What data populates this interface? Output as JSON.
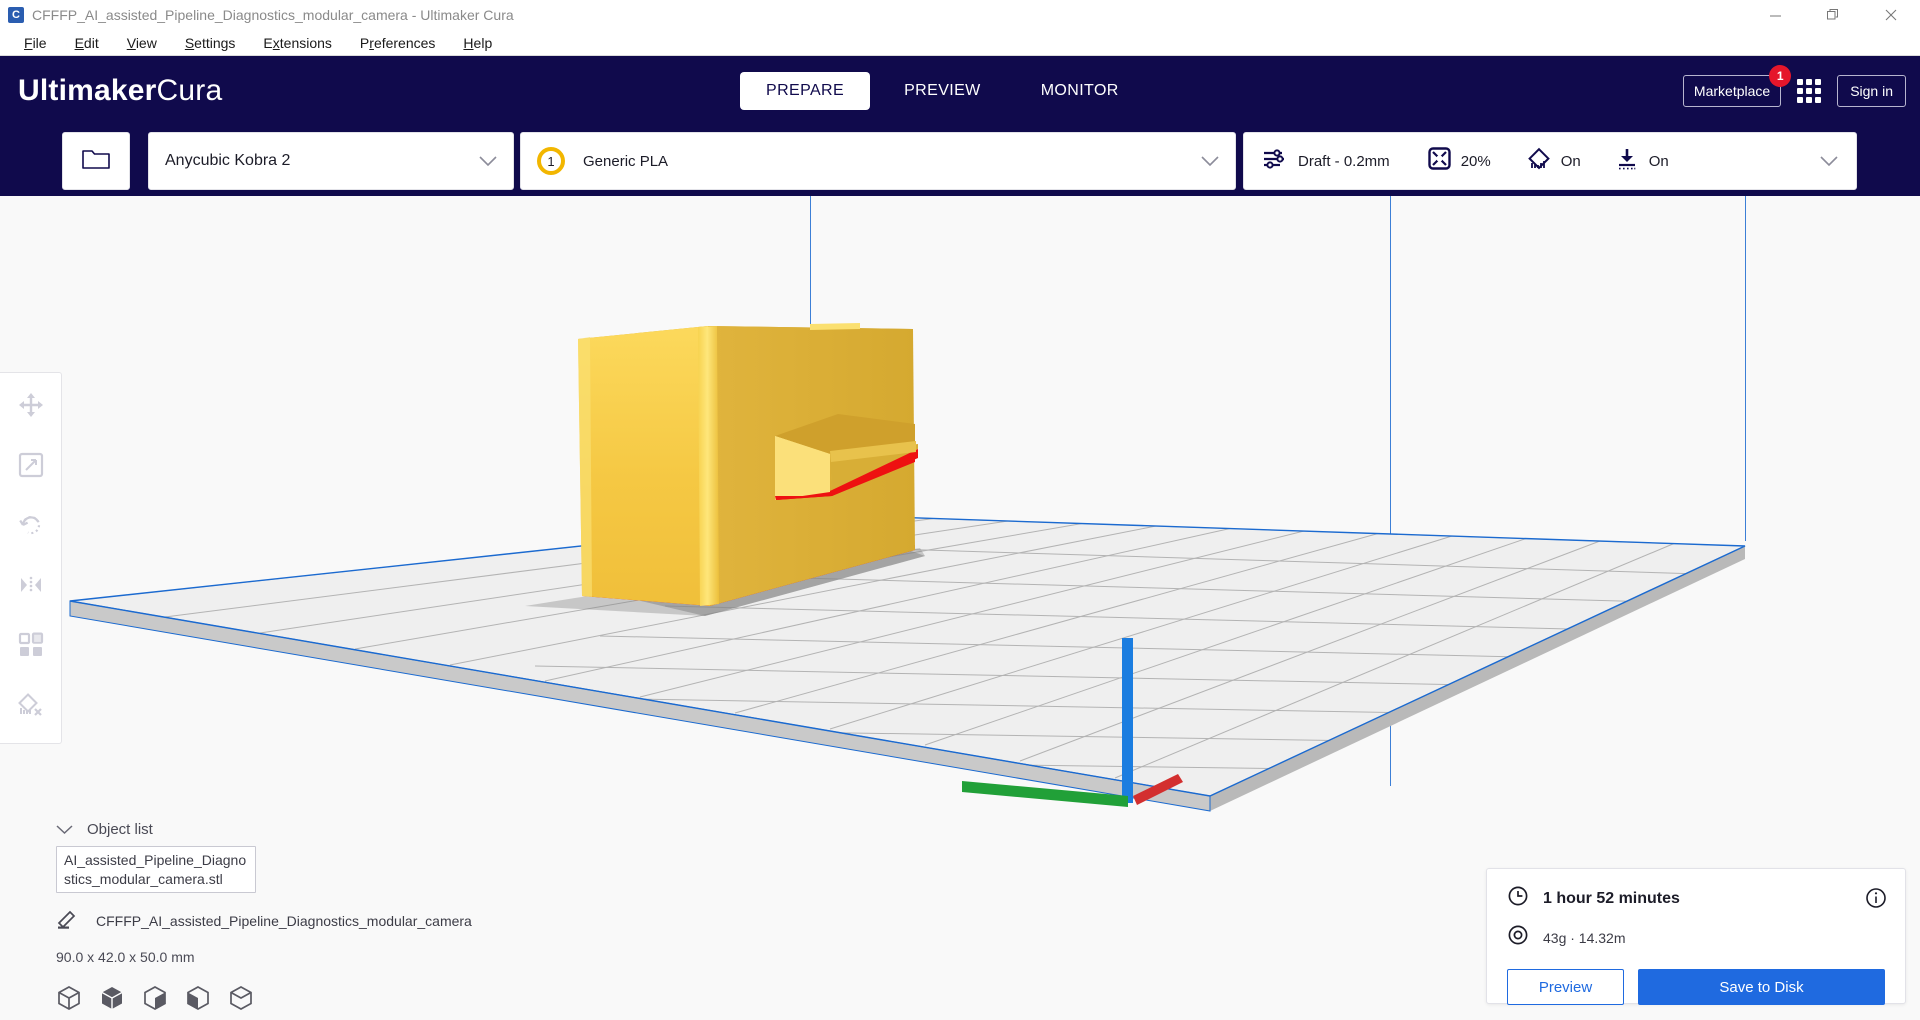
{
  "window": {
    "title": "CFFFP_AI_assisted_Pipeline_Diagnostics_modular_camera - Ultimaker Cura",
    "app_icon": "C",
    "minimize_label": "Minimize",
    "restore_label": "Restore",
    "close_label": "Close"
  },
  "menubar": {
    "items": [
      {
        "pre": "",
        "key": "F",
        "post": "ile"
      },
      {
        "pre": "",
        "key": "E",
        "post": "dit"
      },
      {
        "pre": "",
        "key": "V",
        "post": "iew"
      },
      {
        "pre": "",
        "key": "S",
        "post": "ettings"
      },
      {
        "pre": "E",
        "key": "x",
        "post": "tensions"
      },
      {
        "pre": "P",
        "key": "r",
        "post": "eferences"
      },
      {
        "pre": "",
        "key": "H",
        "post": "elp"
      }
    ]
  },
  "header": {
    "logo_bold": "Ultimaker",
    "logo_light": "Cura",
    "tabs": [
      {
        "label": "PREPARE",
        "active": true
      },
      {
        "label": "PREVIEW",
        "active": false
      },
      {
        "label": "MONITOR",
        "active": false
      }
    ],
    "marketplace_label": "Marketplace",
    "marketplace_badge": "1",
    "apps_icon": "grid-icon",
    "signin_label": "Sign in",
    "background_color": "#100a4c"
  },
  "configbar": {
    "open_file_icon": "folder-icon",
    "printer": "Anycubic Kobra 2",
    "extruder_number": "1",
    "material": "Generic PLA",
    "profile": "Draft - 0.2mm",
    "infill": "20%",
    "support": "On",
    "adhesion": "On"
  },
  "toolbar": {
    "tools": [
      {
        "name": "move-tool",
        "label": "Move"
      },
      {
        "name": "scale-tool",
        "label": "Scale"
      },
      {
        "name": "rotate-tool",
        "label": "Rotate"
      },
      {
        "name": "mirror-tool",
        "label": "Mirror"
      },
      {
        "name": "per-model-settings-tool",
        "label": "Per Model Settings"
      },
      {
        "name": "support-blocker-tool",
        "label": "Support Blocker"
      }
    ]
  },
  "object_list": {
    "header_label": "Object list",
    "tooltip_filename": "AI_assisted_Pipeline_Diagnostics_modular_camera.stl",
    "model_name": "CFFFP_AI_assisted_Pipeline_Diagnostics_modular_camera",
    "dimensions": "90.0 x 42.0 x 50.0 mm",
    "view_icons": [
      "cube-wireframe-icon",
      "cube-solid-icon",
      "cube-xray-icon",
      "cube-layers-icon",
      "cube-outline-icon"
    ]
  },
  "print_info": {
    "time": "1 hour 52 minutes",
    "material": "43g · 14.32m",
    "info_icon": "info-icon",
    "clock_icon": "clock-icon",
    "spool_icon": "spool-icon",
    "preview_label": "Preview",
    "save_label": "Save to Disk",
    "accent_color": "#1f6ae0"
  },
  "viewport": {
    "background_color": "#f9f9f9",
    "buildplate_color": "#efefef",
    "buildplate_edge_color": "#1b6ad0",
    "model_color": "#f2c544",
    "overhang_color": "#ee1111",
    "axis_x_color": "#d32f2f",
    "axis_y_color": "#21a038",
    "axis_z_color": "#1b7de0"
  }
}
